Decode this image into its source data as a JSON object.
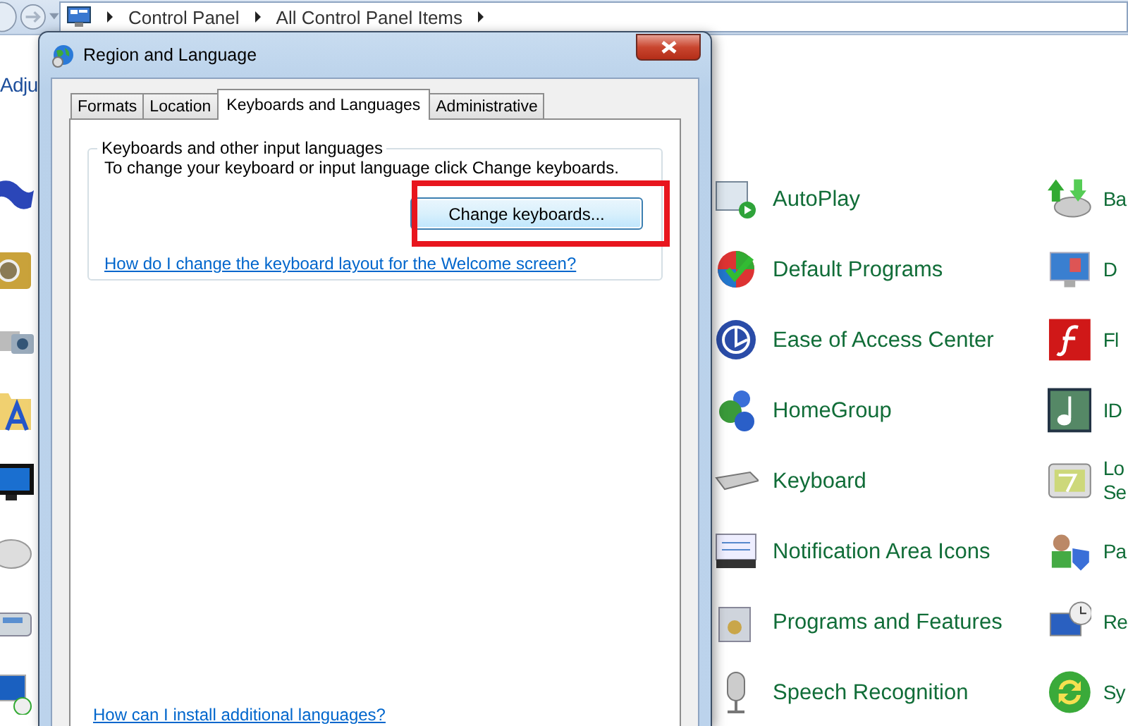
{
  "address_bar": {
    "path": [
      "Control Panel",
      "All Control Panel Items"
    ]
  },
  "heading": "Adju",
  "control_panel": {
    "columns": [
      {
        "items": [
          {
            "label": "AutoPlay"
          },
          {
            "label": "Default Programs"
          },
          {
            "label": "Ease of Access Center"
          },
          {
            "label": "HomeGroup"
          },
          {
            "label": "Keyboard"
          },
          {
            "label": "Notification Area Icons"
          },
          {
            "label": "Programs and Features"
          },
          {
            "label": "Speech Recognition"
          }
        ]
      },
      {
        "items": [
          {
            "label": "Ba"
          },
          {
            "label": "D"
          },
          {
            "label": "Fl"
          },
          {
            "label": "ID"
          },
          {
            "label": "Lo Se"
          },
          {
            "label": "Pa"
          },
          {
            "label": "Re"
          },
          {
            "label": "Sy"
          }
        ]
      }
    ]
  },
  "dialog": {
    "title": "Region and Language",
    "tabs": [
      {
        "label": "Formats",
        "selected": false
      },
      {
        "label": "Location",
        "selected": false
      },
      {
        "label": "Keyboards and Languages",
        "selected": true
      },
      {
        "label": "Administrative",
        "selected": false
      }
    ],
    "group": {
      "legend": "Keyboards and other input languages",
      "text": "To change your keyboard or input language click Change keyboards.",
      "button": "Change keyboards...",
      "link": "How do I change the keyboard layout for the Welcome screen?"
    },
    "bottom_link": "How can I install additional languages?"
  },
  "annotation": {
    "kind": "rectangle",
    "color": "#e8161e"
  }
}
